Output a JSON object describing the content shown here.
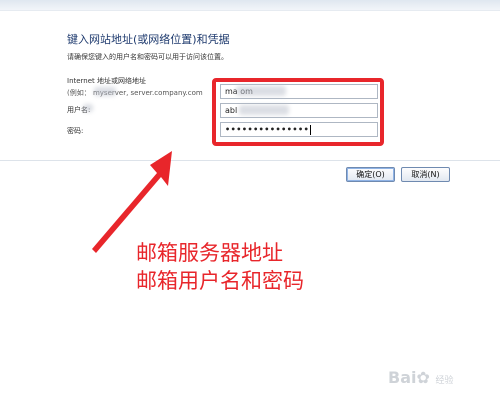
{
  "dialog": {
    "title": "键入网站地址(或网络位置)和凭据",
    "description": "请确保您键入的用户名和密码可以用于访问该位置。"
  },
  "form": {
    "internet_label": "Internet 地址或网络地址",
    "example_label": "(例如： myserver, server.company.com",
    "username_label": "用户名:",
    "password_label": "密码:",
    "server_value": "ma          om",
    "username_value": "abl",
    "password_value": "•••••••••••••••"
  },
  "buttons": {
    "ok_label": "确定(O)",
    "cancel_label": "取消(N)"
  },
  "annotation": {
    "line1": "邮箱服务器地址",
    "line2": "邮箱用户名和密码",
    "color": "#e8262b"
  },
  "watermark": {
    "brand": "Bai",
    "suffix": "经验"
  }
}
